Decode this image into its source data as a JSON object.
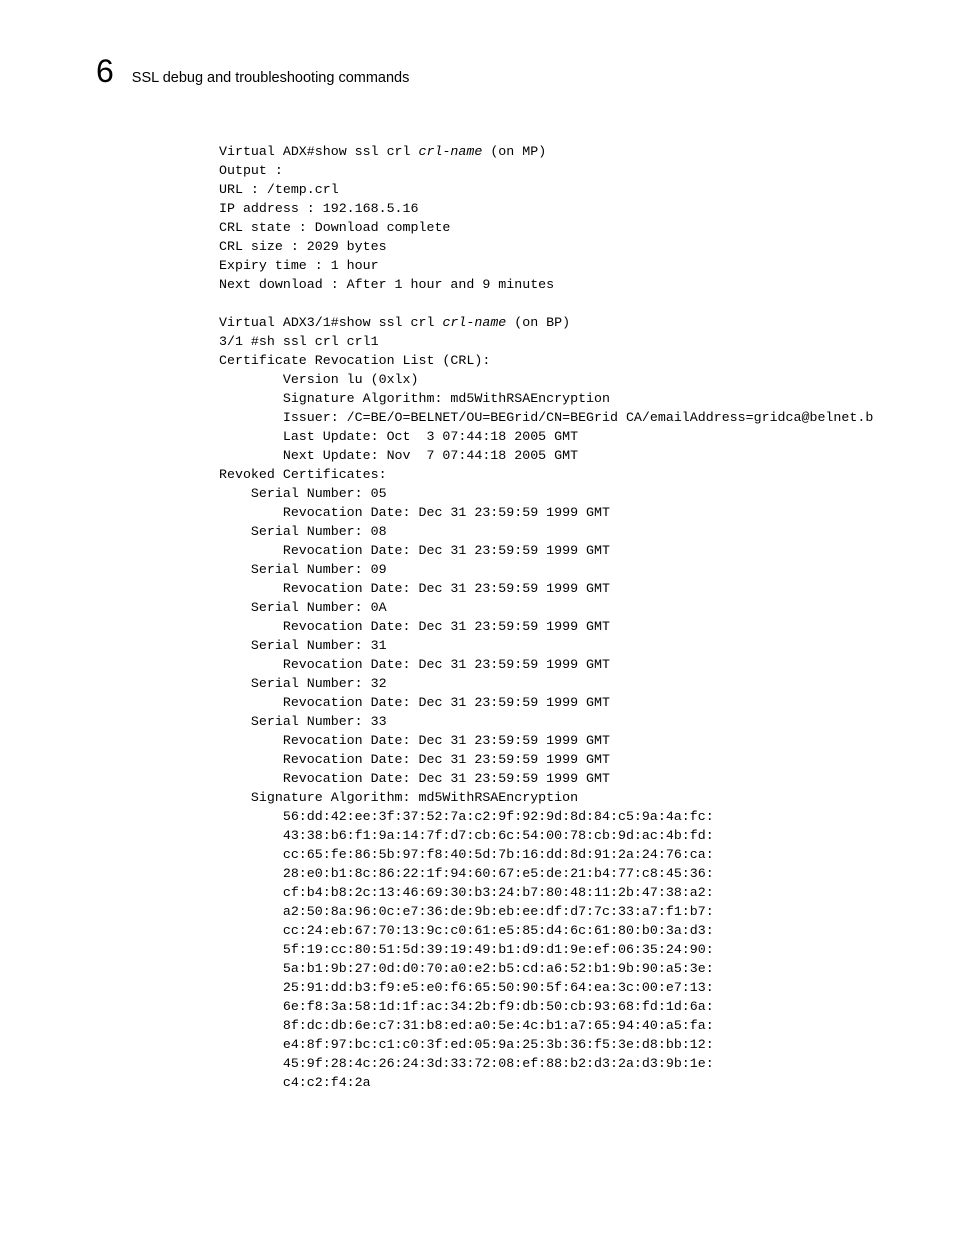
{
  "header": {
    "chapter_number": "6",
    "title": "SSL debug and troubleshooting commands"
  },
  "terminal": {
    "line1a": "Virtual ADX#show ssl crl ",
    "line1b": "crl-name",
    "line1c": " (on MP)",
    "line2": "Output :",
    "line3": "URL : /temp.crl",
    "line4": "IP address : 192.168.5.16",
    "line5": "CRL state : Download complete",
    "line6": "CRL size : 2029 bytes",
    "line7": "Expiry time : 1 hour",
    "line8": "Next download : After 1 hour and 9 minutes",
    "blank1": "",
    "line9a": "Virtual ADX3/1#show ssl crl ",
    "line9b": "crl-name",
    "line9c": " (on BP)",
    "line10": "3/1 #sh ssl crl crl1",
    "line11": "Certificate Revocation List (CRL):",
    "line12": "        Version lu (0xlx)",
    "line13": "        Signature Algorithm: md5WithRSAEncryption",
    "line14": "        Issuer: /C=BE/O=BELNET/OU=BEGrid/CN=BEGrid CA/emailAddress=gridca@belnet.b",
    "line15": "        Last Update: Oct  3 07:44:18 2005 GMT",
    "line16": "        Next Update: Nov  7 07:44:18 2005 GMT",
    "line17": "Revoked Certificates:",
    "line18": "    Serial Number: 05",
    "line19": "        Revocation Date: Dec 31 23:59:59 1999 GMT",
    "line20": "    Serial Number: 08",
    "line21": "        Revocation Date: Dec 31 23:59:59 1999 GMT",
    "line22": "    Serial Number: 09",
    "line23": "        Revocation Date: Dec 31 23:59:59 1999 GMT",
    "line24": "    Serial Number: 0A",
    "line25": "        Revocation Date: Dec 31 23:59:59 1999 GMT",
    "line26": "    Serial Number: 31",
    "line27": "        Revocation Date: Dec 31 23:59:59 1999 GMT",
    "line28": "    Serial Number: 32",
    "line29": "        Revocation Date: Dec 31 23:59:59 1999 GMT",
    "line30": "    Serial Number: 33",
    "line31": "        Revocation Date: Dec 31 23:59:59 1999 GMT",
    "line32": "        Revocation Date: Dec 31 23:59:59 1999 GMT",
    "line33": "        Revocation Date: Dec 31 23:59:59 1999 GMT",
    "line34": "    Signature Algorithm: md5WithRSAEncryption",
    "line35": "        56:dd:42:ee:3f:37:52:7a:c2:9f:92:9d:8d:84:c5:9a:4a:fc:",
    "line36": "        43:38:b6:f1:9a:14:7f:d7:cb:6c:54:00:78:cb:9d:ac:4b:fd:",
    "line37": "        cc:65:fe:86:5b:97:f8:40:5d:7b:16:dd:8d:91:2a:24:76:ca:",
    "line38": "        28:e0:b1:8c:86:22:1f:94:60:67:e5:de:21:b4:77:c8:45:36:",
    "line39": "        cf:b4:b8:2c:13:46:69:30:b3:24:b7:80:48:11:2b:47:38:a2:",
    "line40": "        a2:50:8a:96:0c:e7:36:de:9b:eb:ee:df:d7:7c:33:a7:f1:b7:",
    "line41": "        cc:24:eb:67:70:13:9c:c0:61:e5:85:d4:6c:61:80:b0:3a:d3:",
    "line42": "        5f:19:cc:80:51:5d:39:19:49:b1:d9:d1:9e:ef:06:35:24:90:",
    "line43": "        5a:b1:9b:27:0d:d0:70:a0:e2:b5:cd:a6:52:b1:9b:90:a5:3e:",
    "line44": "        25:91:dd:b3:f9:e5:e0:f6:65:50:90:5f:64:ea:3c:00:e7:13:",
    "line45": "        6e:f8:3a:58:1d:1f:ac:34:2b:f9:db:50:cb:93:68:fd:1d:6a:",
    "line46": "        8f:dc:db:6e:c7:31:b8:ed:a0:5e:4c:b1:a7:65:94:40:a5:fa:",
    "line47": "        e4:8f:97:bc:c1:c0:3f:ed:05:9a:25:3b:36:f5:3e:d8:bb:12:",
    "line48": "        45:9f:28:4c:26:24:3d:33:72:08:ef:88:b2:d3:2a:d3:9b:1e:",
    "line49": "        c4:c2:f4:2a"
  }
}
